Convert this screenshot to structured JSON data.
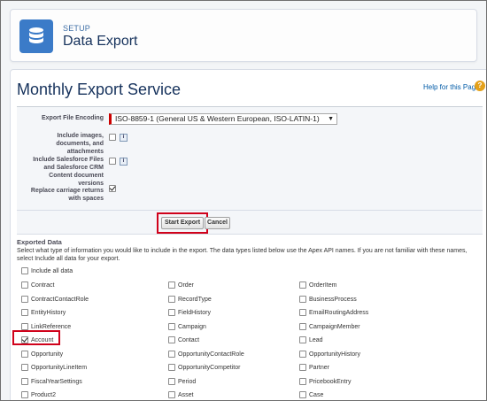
{
  "header": {
    "sub": "SETUP",
    "title": "Data Export",
    "icon": "database-icon"
  },
  "page": {
    "title": "Monthly Export Service",
    "help": "Help for this Page"
  },
  "form": {
    "encoding_label": "Export File Encoding",
    "encoding_value": "ISO-8859-1 (General US & Western European, ISO-LATIN-1)",
    "images_label": "Include images, documents, and attachments",
    "images_checked": false,
    "sf_files_label": "Include Salesforce Files and Salesforce CRM Content document versions",
    "sf_files_checked": false,
    "carriage_label": "Replace carriage returns with spaces",
    "carriage_checked": true
  },
  "buttons": {
    "start": "Start Export",
    "cancel": "Cancel"
  },
  "exported": {
    "title": "Exported Data",
    "desc": "Select what type of information you would like to include in the export. The data types listed below use the Apex API names. If you are not familiar with these names, select Include all data for your export.",
    "include_all": "Include all data",
    "rows": [
      [
        "Contract",
        "Order",
        "OrderItem"
      ],
      [
        "ContractContactRole",
        "RecordType",
        "BusinessProcess"
      ],
      [
        "EntityHistory",
        "FieldHistory",
        "EmailRoutingAddress"
      ],
      [
        "LinkReference",
        "Campaign",
        "CampaignMember"
      ],
      [
        "Account",
        "Contact",
        "Lead"
      ],
      [
        "Opportunity",
        "OpportunityContactRole",
        "OpportunityHistory"
      ],
      [
        "OpportunityLineItem",
        "OpportunityCompetitor",
        "Partner"
      ],
      [
        "FiscalYearSettings",
        "Period",
        "PricebookEntry"
      ],
      [
        "Product2",
        "Asset",
        "Case"
      ]
    ],
    "checked": [
      "Account"
    ]
  },
  "colors": {
    "accent": "#3b7bc8",
    "highlight": "#d0021b"
  }
}
